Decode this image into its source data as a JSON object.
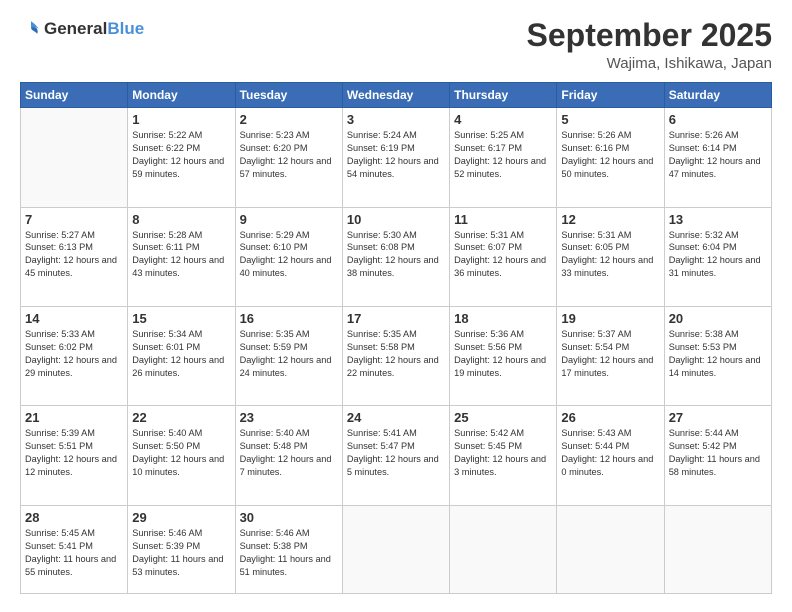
{
  "logo": {
    "general": "General",
    "blue": "Blue"
  },
  "header": {
    "month": "September 2025",
    "location": "Wajima, Ishikawa, Japan"
  },
  "days": [
    "Sunday",
    "Monday",
    "Tuesday",
    "Wednesday",
    "Thursday",
    "Friday",
    "Saturday"
  ],
  "weeks": [
    [
      {
        "day": "",
        "sunrise": "",
        "sunset": "",
        "daylight": ""
      },
      {
        "day": "1",
        "sunrise": "Sunrise: 5:22 AM",
        "sunset": "Sunset: 6:22 PM",
        "daylight": "Daylight: 12 hours and 59 minutes."
      },
      {
        "day": "2",
        "sunrise": "Sunrise: 5:23 AM",
        "sunset": "Sunset: 6:20 PM",
        "daylight": "Daylight: 12 hours and 57 minutes."
      },
      {
        "day": "3",
        "sunrise": "Sunrise: 5:24 AM",
        "sunset": "Sunset: 6:19 PM",
        "daylight": "Daylight: 12 hours and 54 minutes."
      },
      {
        "day": "4",
        "sunrise": "Sunrise: 5:25 AM",
        "sunset": "Sunset: 6:17 PM",
        "daylight": "Daylight: 12 hours and 52 minutes."
      },
      {
        "day": "5",
        "sunrise": "Sunrise: 5:26 AM",
        "sunset": "Sunset: 6:16 PM",
        "daylight": "Daylight: 12 hours and 50 minutes."
      },
      {
        "day": "6",
        "sunrise": "Sunrise: 5:26 AM",
        "sunset": "Sunset: 6:14 PM",
        "daylight": "Daylight: 12 hours and 47 minutes."
      }
    ],
    [
      {
        "day": "7",
        "sunrise": "Sunrise: 5:27 AM",
        "sunset": "Sunset: 6:13 PM",
        "daylight": "Daylight: 12 hours and 45 minutes."
      },
      {
        "day": "8",
        "sunrise": "Sunrise: 5:28 AM",
        "sunset": "Sunset: 6:11 PM",
        "daylight": "Daylight: 12 hours and 43 minutes."
      },
      {
        "day": "9",
        "sunrise": "Sunrise: 5:29 AM",
        "sunset": "Sunset: 6:10 PM",
        "daylight": "Daylight: 12 hours and 40 minutes."
      },
      {
        "day": "10",
        "sunrise": "Sunrise: 5:30 AM",
        "sunset": "Sunset: 6:08 PM",
        "daylight": "Daylight: 12 hours and 38 minutes."
      },
      {
        "day": "11",
        "sunrise": "Sunrise: 5:31 AM",
        "sunset": "Sunset: 6:07 PM",
        "daylight": "Daylight: 12 hours and 36 minutes."
      },
      {
        "day": "12",
        "sunrise": "Sunrise: 5:31 AM",
        "sunset": "Sunset: 6:05 PM",
        "daylight": "Daylight: 12 hours and 33 minutes."
      },
      {
        "day": "13",
        "sunrise": "Sunrise: 5:32 AM",
        "sunset": "Sunset: 6:04 PM",
        "daylight": "Daylight: 12 hours and 31 minutes."
      }
    ],
    [
      {
        "day": "14",
        "sunrise": "Sunrise: 5:33 AM",
        "sunset": "Sunset: 6:02 PM",
        "daylight": "Daylight: 12 hours and 29 minutes."
      },
      {
        "day": "15",
        "sunrise": "Sunrise: 5:34 AM",
        "sunset": "Sunset: 6:01 PM",
        "daylight": "Daylight: 12 hours and 26 minutes."
      },
      {
        "day": "16",
        "sunrise": "Sunrise: 5:35 AM",
        "sunset": "Sunset: 5:59 PM",
        "daylight": "Daylight: 12 hours and 24 minutes."
      },
      {
        "day": "17",
        "sunrise": "Sunrise: 5:35 AM",
        "sunset": "Sunset: 5:58 PM",
        "daylight": "Daylight: 12 hours and 22 minutes."
      },
      {
        "day": "18",
        "sunrise": "Sunrise: 5:36 AM",
        "sunset": "Sunset: 5:56 PM",
        "daylight": "Daylight: 12 hours and 19 minutes."
      },
      {
        "day": "19",
        "sunrise": "Sunrise: 5:37 AM",
        "sunset": "Sunset: 5:54 PM",
        "daylight": "Daylight: 12 hours and 17 minutes."
      },
      {
        "day": "20",
        "sunrise": "Sunrise: 5:38 AM",
        "sunset": "Sunset: 5:53 PM",
        "daylight": "Daylight: 12 hours and 14 minutes."
      }
    ],
    [
      {
        "day": "21",
        "sunrise": "Sunrise: 5:39 AM",
        "sunset": "Sunset: 5:51 PM",
        "daylight": "Daylight: 12 hours and 12 minutes."
      },
      {
        "day": "22",
        "sunrise": "Sunrise: 5:40 AM",
        "sunset": "Sunset: 5:50 PM",
        "daylight": "Daylight: 12 hours and 10 minutes."
      },
      {
        "day": "23",
        "sunrise": "Sunrise: 5:40 AM",
        "sunset": "Sunset: 5:48 PM",
        "daylight": "Daylight: 12 hours and 7 minutes."
      },
      {
        "day": "24",
        "sunrise": "Sunrise: 5:41 AM",
        "sunset": "Sunset: 5:47 PM",
        "daylight": "Daylight: 12 hours and 5 minutes."
      },
      {
        "day": "25",
        "sunrise": "Sunrise: 5:42 AM",
        "sunset": "Sunset: 5:45 PM",
        "daylight": "Daylight: 12 hours and 3 minutes."
      },
      {
        "day": "26",
        "sunrise": "Sunrise: 5:43 AM",
        "sunset": "Sunset: 5:44 PM",
        "daylight": "Daylight: 12 hours and 0 minutes."
      },
      {
        "day": "27",
        "sunrise": "Sunrise: 5:44 AM",
        "sunset": "Sunset: 5:42 PM",
        "daylight": "Daylight: 11 hours and 58 minutes."
      }
    ],
    [
      {
        "day": "28",
        "sunrise": "Sunrise: 5:45 AM",
        "sunset": "Sunset: 5:41 PM",
        "daylight": "Daylight: 11 hours and 55 minutes."
      },
      {
        "day": "29",
        "sunrise": "Sunrise: 5:46 AM",
        "sunset": "Sunset: 5:39 PM",
        "daylight": "Daylight: 11 hours and 53 minutes."
      },
      {
        "day": "30",
        "sunrise": "Sunrise: 5:46 AM",
        "sunset": "Sunset: 5:38 PM",
        "daylight": "Daylight: 11 hours and 51 minutes."
      },
      {
        "day": "",
        "sunrise": "",
        "sunset": "",
        "daylight": ""
      },
      {
        "day": "",
        "sunrise": "",
        "sunset": "",
        "daylight": ""
      },
      {
        "day": "",
        "sunrise": "",
        "sunset": "",
        "daylight": ""
      },
      {
        "day": "",
        "sunrise": "",
        "sunset": "",
        "daylight": ""
      }
    ]
  ]
}
